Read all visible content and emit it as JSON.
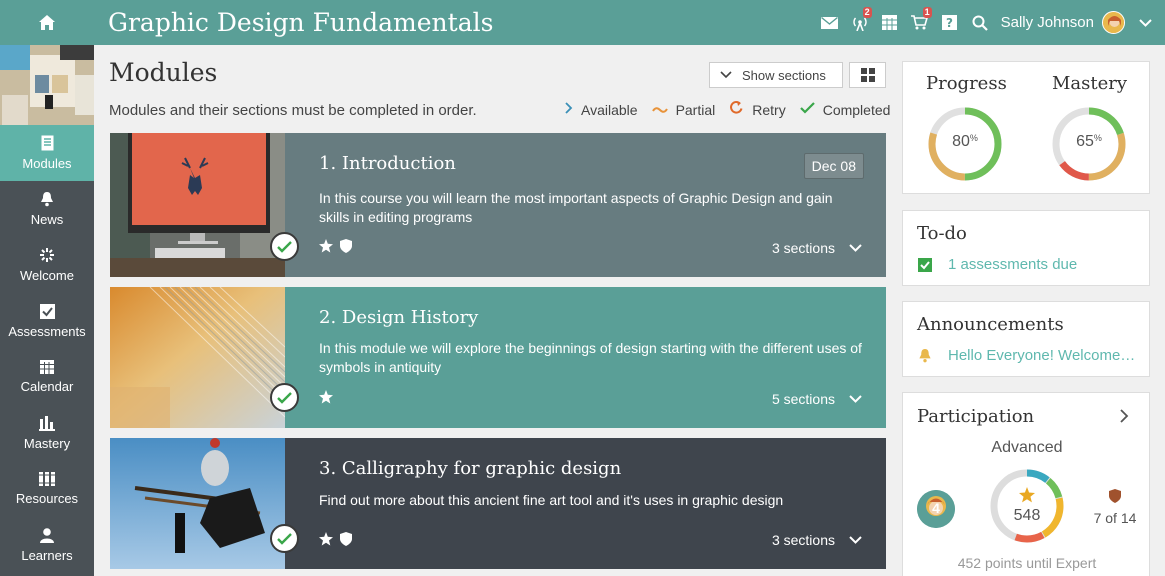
{
  "header": {
    "course_title": "Graphic Design Fundamentals",
    "notifications_badge": "2",
    "cart_badge": "1",
    "user_name": "Sally Johnson"
  },
  "sidebar": {
    "items": [
      {
        "label": "Modules",
        "icon": "modules-icon",
        "active": true
      },
      {
        "label": "News",
        "icon": "bell-icon"
      },
      {
        "label": "Welcome",
        "icon": "welcome-icon"
      },
      {
        "label": "Assessments",
        "icon": "assessments-icon"
      },
      {
        "label": "Calendar",
        "icon": "calendar-icon"
      },
      {
        "label": "Mastery",
        "icon": "mastery-icon"
      },
      {
        "label": "Resources",
        "icon": "resources-icon"
      },
      {
        "label": "Learners",
        "icon": "learners-icon"
      }
    ]
  },
  "main": {
    "title": "Modules",
    "subtitle": "Modules and their sections must be completed in order.",
    "show_sections_label": "Show sections",
    "legend": [
      {
        "label": "Available",
        "icon": "chevron-right-icon",
        "color": "#3a8fb7"
      },
      {
        "label": "Partial",
        "icon": "tilde-icon",
        "color": "#e8933a"
      },
      {
        "label": "Retry",
        "icon": "retry-icon",
        "color": "#e06a2a"
      },
      {
        "label": "Completed",
        "icon": "check-icon",
        "color": "#3aa64a"
      }
    ],
    "modules": [
      {
        "title": "1. Introduction",
        "date": "Dec 08",
        "description": "In this course you will learn the most important aspects of Graphic Design and gain skills in editing programs",
        "sections": "3 sections",
        "color": "#677c80"
      },
      {
        "title": "2. Design History",
        "description": "In this module we will explore the beginnings of design starting with the different uses of symbols in antiquity",
        "sections": "5 sections",
        "color": "#5a9f97"
      },
      {
        "title": "3. Calligraphy for graphic design",
        "description": "Find out more about this ancient fine art tool and it's uses in graphic design",
        "sections": "3 sections",
        "color": "#3f454d"
      }
    ]
  },
  "progress_panel": {
    "progress_label": "Progress",
    "progress_value": "80",
    "mastery_label": "Mastery",
    "mastery_value": "65",
    "percent_sign": "%"
  },
  "todo_panel": {
    "title": "To-do",
    "item": "1 assessments due"
  },
  "announcements_panel": {
    "title": "Announcements",
    "item": "Hello Everyone! Welcome…"
  },
  "participation_panel": {
    "title": "Participation",
    "level": "Advanced",
    "avatar_number": "4",
    "points": "548",
    "rank": "7 of 14",
    "footer": "452 points until Expert"
  },
  "colors": {
    "topbar": "#5a9f97",
    "sidebar": "#4a5156",
    "sidebar_active": "#5fb3a8",
    "link": "#5fb8ae"
  }
}
